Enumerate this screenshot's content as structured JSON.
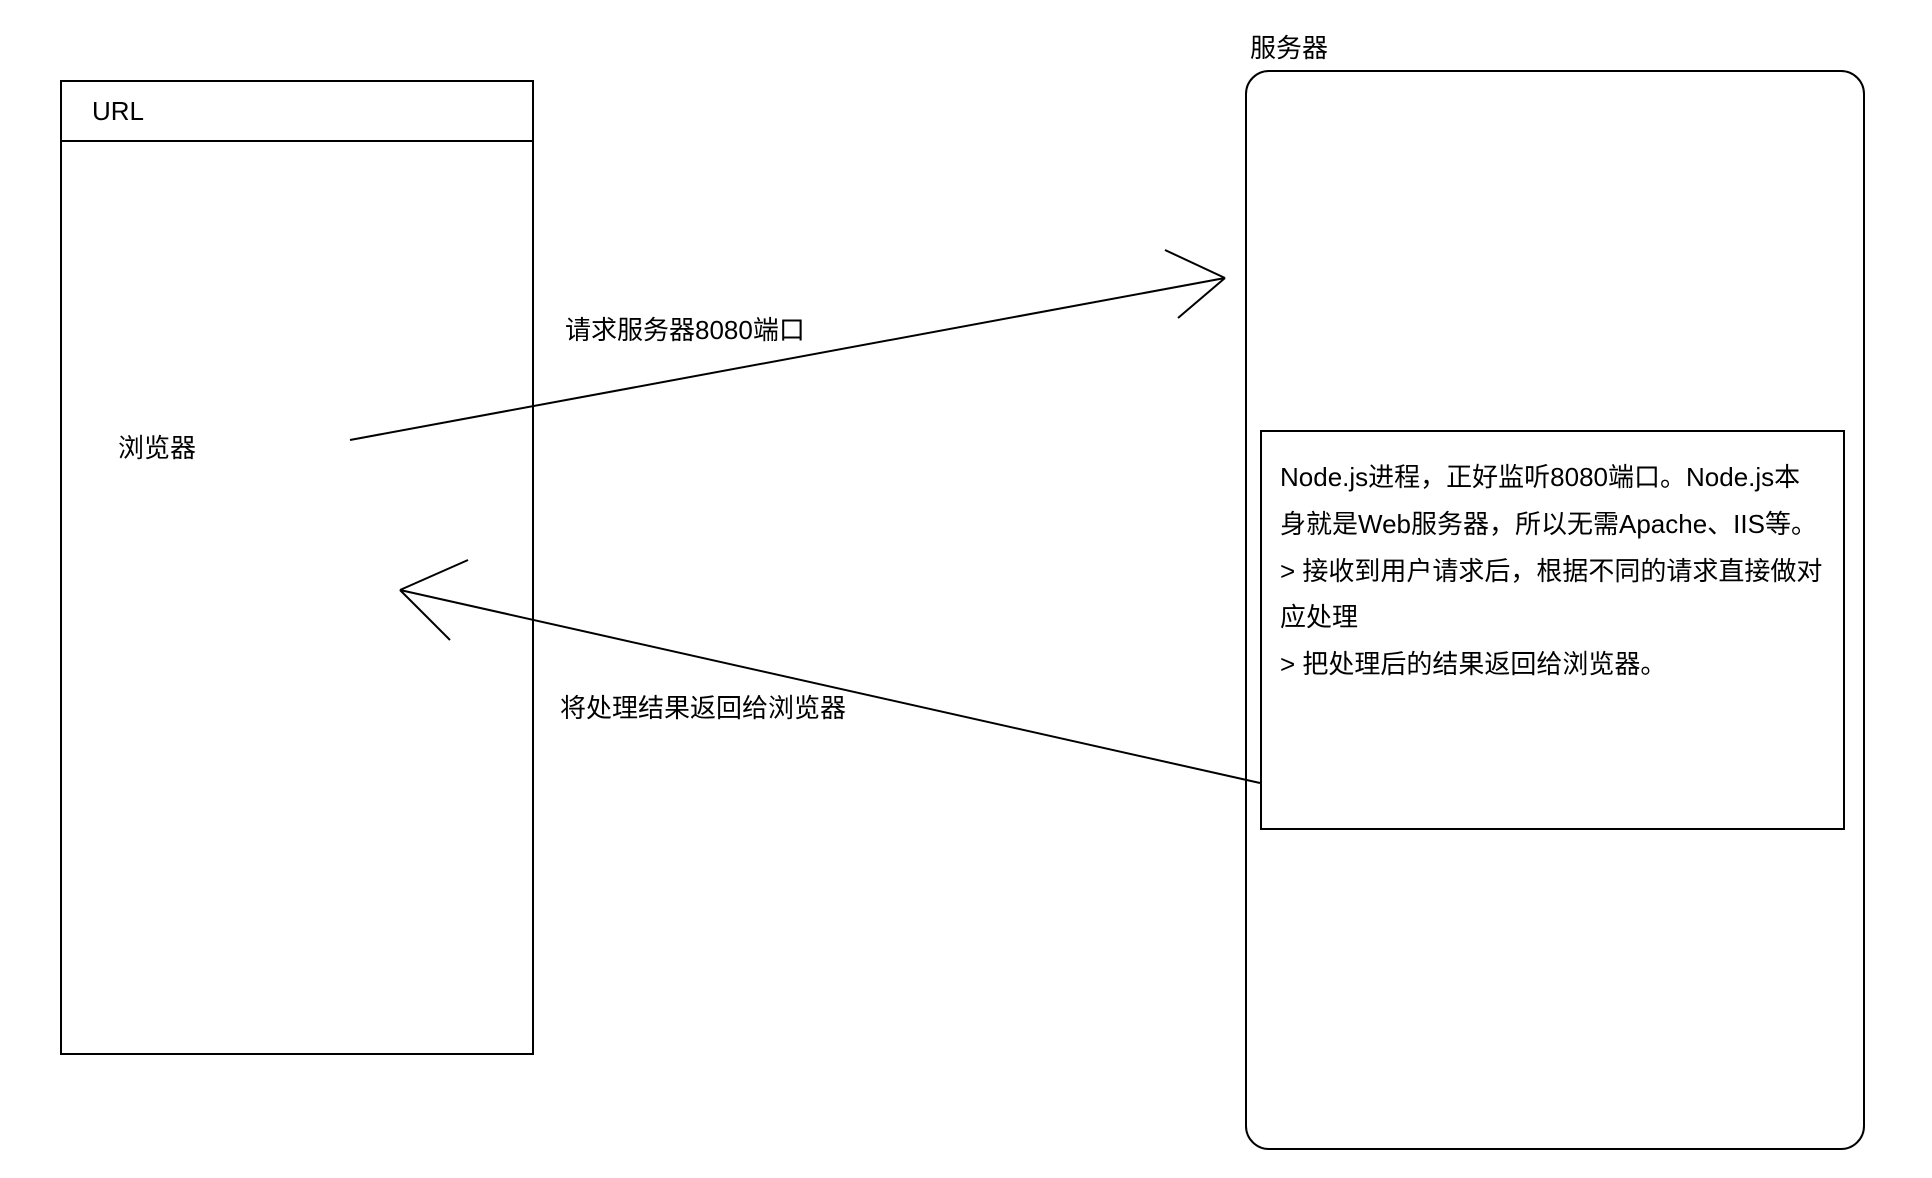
{
  "browser": {
    "url_label": "URL",
    "name": "浏览器"
  },
  "server": {
    "title": "服务器",
    "nodejs_text": "Node.js进程，正好监听8080端口。Node.js本身就是Web服务器，所以无需Apache、IIS等。\n> 接收到用户请求后，根据不同的请求直接做对应处理\n> 把处理后的结果返回给浏览器。"
  },
  "arrows": {
    "request_label": "请求服务器8080端口",
    "response_label": "将处理结果返回给浏览器"
  }
}
